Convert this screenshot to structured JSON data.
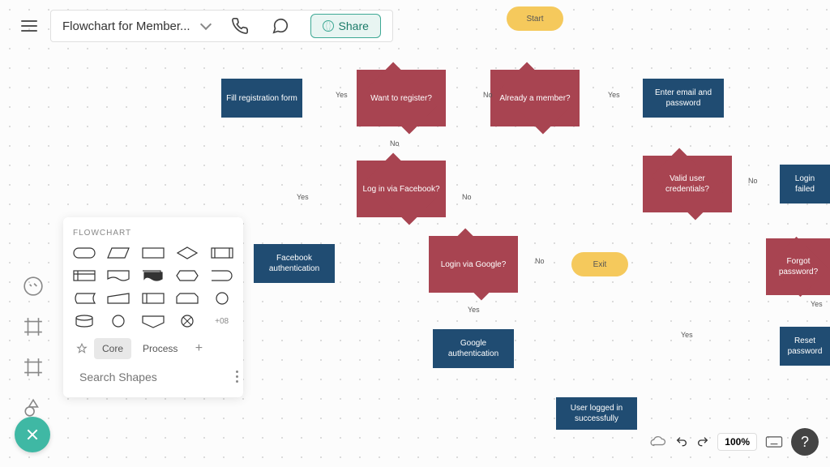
{
  "header": {
    "title": "Flowchart for Member...",
    "share_label": "Share"
  },
  "shapes_panel": {
    "title": "FLOWCHART",
    "more_label": "+08",
    "tabs": {
      "core": "Core",
      "process": "Process"
    },
    "search_placeholder": "Search Shapes"
  },
  "footer": {
    "zoom": "100%"
  },
  "flowchart": {
    "nodes": {
      "start": "Start",
      "already_member": "Already a member?",
      "want_register": "Want to register?",
      "fill_form": "Fill registration form",
      "login_facebook": "Log in via Facebook?",
      "facebook_auth": "Facebook authentication",
      "login_google": "Login via Google?",
      "google_auth": "Google authentication",
      "exit": "Exit",
      "enter_email": "Enter email and password",
      "valid_creds": "Valid user credentials?",
      "login_failed": "Login failed",
      "forgot_pw": "Forgot password?",
      "reset_pw": "Reset password",
      "logged_in": "User logged in successfully"
    },
    "edge_labels": {
      "yes": "Yes",
      "no": "No"
    }
  }
}
